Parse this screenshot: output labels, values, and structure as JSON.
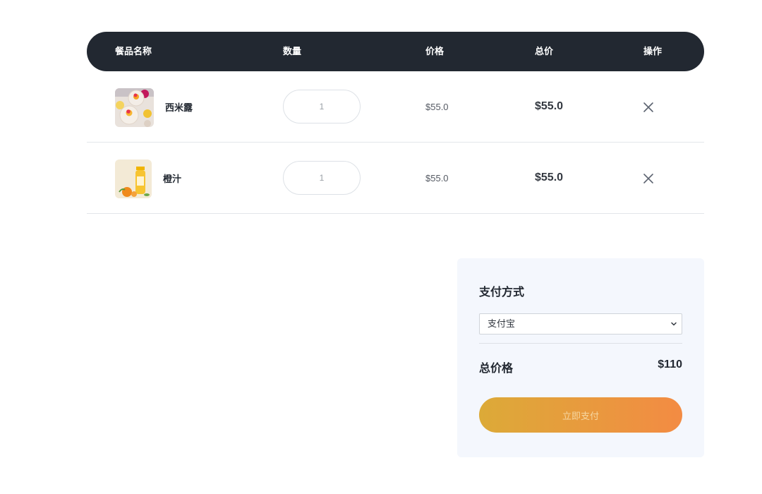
{
  "table": {
    "headers": {
      "name": "餐品名称",
      "quantity": "数量",
      "price": "价格",
      "total": "总价",
      "action": "操作"
    },
    "rows": [
      {
        "name": "西米露",
        "quantity": "1",
        "price": "$55.0",
        "total": "$55.0",
        "image": "sago-dessert-photo",
        "remove_icon": "close-icon"
      },
      {
        "name": "橙汁",
        "quantity": "1",
        "price": "$55.0",
        "total": "$55.0",
        "image": "orange-juice-photo",
        "remove_icon": "close-icon"
      }
    ]
  },
  "payment": {
    "title": "支付方式",
    "method": "支付宝",
    "method_icon": "chevron-down-icon",
    "total_label": "总价格",
    "total_value": "$110",
    "pay_button": "立即支付"
  },
  "colors": {
    "header_bg": "#222831",
    "panel_bg": "#f4f7fd",
    "button_gradient_start": "#dcaa38",
    "button_gradient_end": "#f38b43"
  }
}
